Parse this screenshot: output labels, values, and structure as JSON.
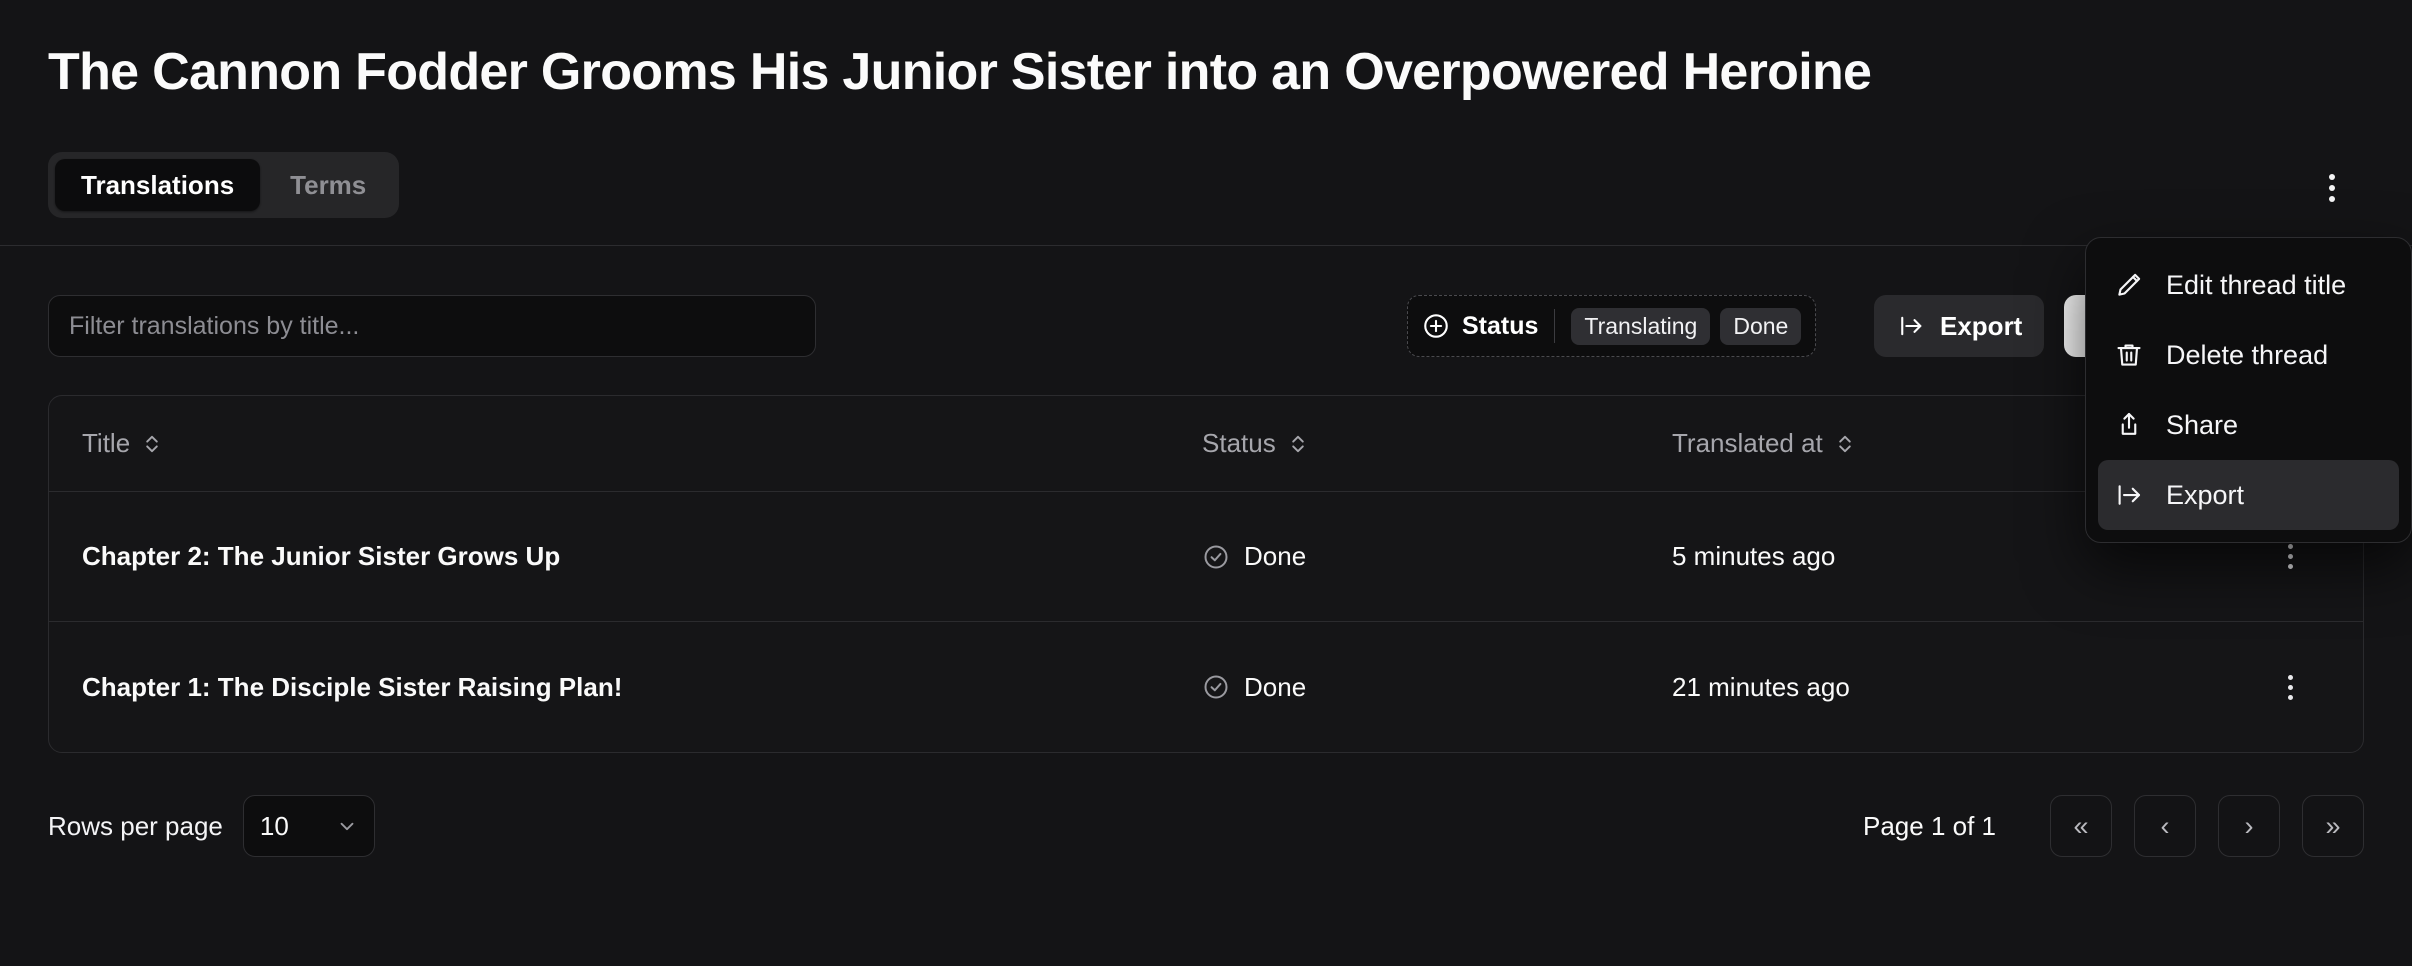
{
  "header": {
    "title": "The Cannon Fodder Grooms His Junior Sister into an Overpowered Heroine",
    "kebab_icon": "kebab-vertical-icon"
  },
  "tabs": [
    {
      "label": "Translations",
      "active": true
    },
    {
      "label": "Terms",
      "active": false
    }
  ],
  "toolbar": {
    "filter_placeholder": "Filter translations by title...",
    "filter_value": "",
    "status_filter": {
      "icon": "plus-circle-icon",
      "label": "Status",
      "selected": [
        "Translating",
        "Done"
      ]
    },
    "export": {
      "icon": "export-icon",
      "label": "Export"
    }
  },
  "table": {
    "columns": [
      {
        "label": "Title",
        "sort_icon": "chevron-up-down-icon"
      },
      {
        "label": "Status",
        "sort_icon": "chevron-up-down-icon"
      },
      {
        "label": "Translated at",
        "sort_icon": "chevron-up-down-icon"
      }
    ],
    "rows": [
      {
        "title": "Chapter 2: The Junior Sister Grows Up",
        "status": "Done",
        "status_icon": "circle-check-icon",
        "translated_at": "5 minutes ago",
        "action_icon": "kebab-vertical-icon"
      },
      {
        "title": "Chapter 1: The Disciple Sister Raising Plan!",
        "status": "Done",
        "status_icon": "circle-check-icon",
        "translated_at": "21 minutes ago",
        "action_icon": "kebab-vertical-icon"
      }
    ]
  },
  "footer": {
    "rows_per_page_label": "Rows per page",
    "rows_per_page_value": "10",
    "rows_per_page_icon": "chevron-down-icon",
    "page_info": "Page 1 of 1",
    "pagination": [
      {
        "label": "«",
        "name": "first-page-button"
      },
      {
        "label": "‹",
        "name": "previous-page-button"
      },
      {
        "label": "›",
        "name": "next-page-button"
      },
      {
        "label": "»",
        "name": "last-page-button"
      }
    ]
  },
  "menu": {
    "items": [
      {
        "label": "Edit thread title",
        "icon": "pencil-icon",
        "highlight": false
      },
      {
        "label": "Delete thread",
        "icon": "trash-icon",
        "highlight": false
      },
      {
        "label": "Share",
        "icon": "share-icon",
        "highlight": false
      },
      {
        "label": "Export",
        "icon": "export-icon",
        "highlight": true
      }
    ]
  },
  "colors": {
    "background": "#141416",
    "surface": "#151517",
    "border": "#2b2b2e",
    "text": "#fafafa",
    "muted": "#a6a6ac",
    "accent_white": "#fafafa",
    "tab_active_bg": "#0c0c0d",
    "tabs_bg": "#262628"
  }
}
